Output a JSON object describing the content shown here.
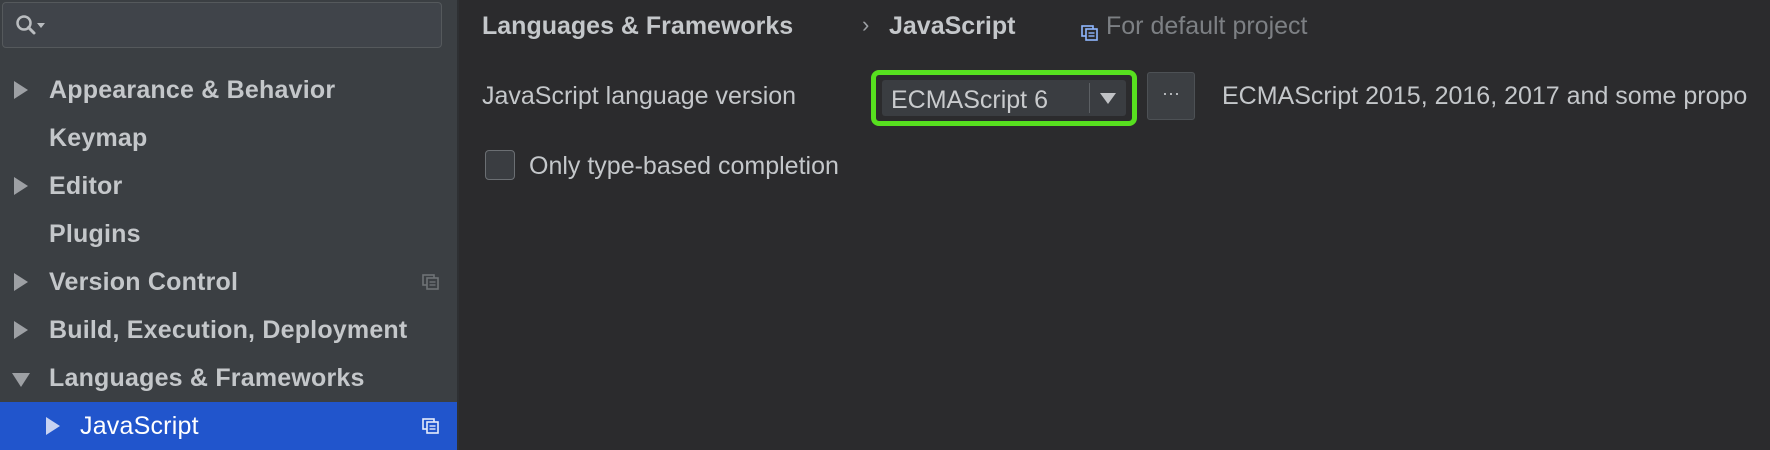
{
  "search": {
    "value": "",
    "placeholder": ""
  },
  "sidebar": {
    "items": [
      {
        "label": "Appearance & Behavior",
        "expander": "collapsed",
        "project_scope": false
      },
      {
        "label": "Keymap",
        "expander": "none",
        "project_scope": false
      },
      {
        "label": "Editor",
        "expander": "collapsed",
        "project_scope": false
      },
      {
        "label": "Plugins",
        "expander": "none",
        "project_scope": false
      },
      {
        "label": "Version Control",
        "expander": "collapsed",
        "project_scope": true
      },
      {
        "label": "Build, Execution, Deployment",
        "expander": "collapsed",
        "project_scope": false
      },
      {
        "label": "Languages & Frameworks",
        "expander": "expanded",
        "project_scope": false
      },
      {
        "label": "JavaScript",
        "expander": "collapsed",
        "project_scope": true,
        "selected": true
      }
    ]
  },
  "breadcrumb": {
    "parent": "Languages & Frameworks",
    "separator": "›",
    "current": "JavaScript",
    "scope": "For default project"
  },
  "language_version": {
    "label": "JavaScript language version",
    "selected": "ECMAScript 6",
    "more_label": "···",
    "description": "ECMAScript 2015, 2016, 2017 and some propo"
  },
  "options": {
    "type_based_completion": {
      "label": "Only type-based completion",
      "checked": false
    }
  },
  "colors": {
    "selection": "#2155cc",
    "highlight": "#57e01f",
    "background": "#2b2b2d",
    "sidebar": "#3b3f43"
  }
}
